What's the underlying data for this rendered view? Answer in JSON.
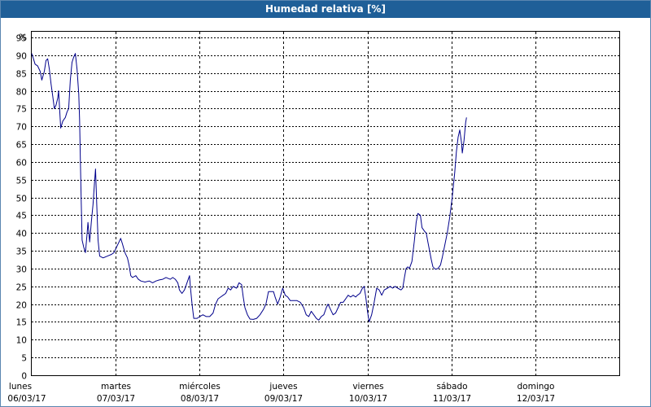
{
  "chart_data": {
    "type": "line",
    "title": "Humedad relativa [%]",
    "ylabel": "%",
    "xlabel": "",
    "ylim": [
      0,
      95
    ],
    "yticks": [
      0,
      5,
      10,
      15,
      20,
      25,
      30,
      35,
      40,
      45,
      50,
      55,
      60,
      65,
      70,
      75,
      80,
      85,
      90,
      95
    ],
    "xlim": [
      0,
      7
    ],
    "day_ticks": [
      {
        "day": "lunes",
        "date": "06/03/17"
      },
      {
        "day": "martes",
        "date": "07/03/17"
      },
      {
        "day": "miércoles",
        "date": "08/03/17"
      },
      {
        "day": "jueves",
        "date": "09/03/17"
      },
      {
        "day": "viernes",
        "date": "10/03/17"
      },
      {
        "day": "sábado",
        "date": "11/03/17"
      },
      {
        "day": "domingo",
        "date": "12/03/17"
      }
    ],
    "grid": true,
    "line_color": "#00008b",
    "series": [
      {
        "name": "",
        "points": [
          [
            0.0,
            90.5
          ],
          [
            0.02,
            89.0
          ],
          [
            0.04,
            87.5
          ],
          [
            0.07,
            87.0
          ],
          [
            0.1,
            85.5
          ],
          [
            0.12,
            83.0
          ],
          [
            0.15,
            85.5
          ],
          [
            0.17,
            88.5
          ],
          [
            0.19,
            89.0
          ],
          [
            0.21,
            86.0
          ],
          [
            0.23,
            82.0
          ],
          [
            0.25,
            78.5
          ],
          [
            0.27,
            75.0
          ],
          [
            0.29,
            76.0
          ],
          [
            0.31,
            78.0
          ],
          [
            0.32,
            80.0
          ],
          [
            0.33,
            76.0
          ],
          [
            0.345,
            69.5
          ],
          [
            0.37,
            71.5
          ],
          [
            0.4,
            72.5
          ],
          [
            0.42,
            74.0
          ],
          [
            0.44,
            75.0
          ],
          [
            0.46,
            83.0
          ],
          [
            0.48,
            88.0
          ],
          [
            0.5,
            89.5
          ],
          [
            0.52,
            90.5
          ],
          [
            0.54,
            86.0
          ],
          [
            0.56,
            79.0
          ],
          [
            0.57,
            72.0
          ],
          [
            0.58,
            60.0
          ],
          [
            0.59,
            48.0
          ],
          [
            0.6,
            38.0
          ],
          [
            0.62,
            36.0
          ],
          [
            0.64,
            34.5
          ],
          [
            0.66,
            40.0
          ],
          [
            0.67,
            43.0
          ],
          [
            0.69,
            37.5
          ],
          [
            0.71,
            43.0
          ],
          [
            0.73,
            48.0
          ],
          [
            0.75,
            55.0
          ],
          [
            0.76,
            58.0
          ],
          [
            0.775,
            48.0
          ],
          [
            0.79,
            38.0
          ],
          [
            0.81,
            33.5
          ],
          [
            0.85,
            33.0
          ],
          [
            0.9,
            33.5
          ],
          [
            0.95,
            34.0
          ],
          [
            0.98,
            34.5
          ],
          [
            1.0,
            35.5
          ],
          [
            1.04,
            37.5
          ],
          [
            1.06,
            38.5
          ],
          [
            1.08,
            37.0
          ],
          [
            1.11,
            34.5
          ],
          [
            1.14,
            33.0
          ],
          [
            1.16,
            31.0
          ],
          [
            1.18,
            28.0
          ],
          [
            1.2,
            27.5
          ],
          [
            1.24,
            28.0
          ],
          [
            1.27,
            27.0
          ],
          [
            1.3,
            26.5
          ],
          [
            1.35,
            26.2
          ],
          [
            1.4,
            26.5
          ],
          [
            1.44,
            26.0
          ],
          [
            1.48,
            26.5
          ],
          [
            1.52,
            26.8
          ],
          [
            1.56,
            27.0
          ],
          [
            1.6,
            27.5
          ],
          [
            1.65,
            27.0
          ],
          [
            1.68,
            27.5
          ],
          [
            1.71,
            27.0
          ],
          [
            1.74,
            26.0
          ],
          [
            1.76,
            24.0
          ],
          [
            1.79,
            23.0
          ],
          [
            1.82,
            24.0
          ],
          [
            1.85,
            26.0
          ],
          [
            1.88,
            28.0
          ],
          [
            1.89,
            25.0
          ],
          [
            1.91,
            20.0
          ],
          [
            1.93,
            16.0
          ],
          [
            1.97,
            16.0
          ],
          [
            2.0,
            16.5
          ],
          [
            2.04,
            17.0
          ],
          [
            2.08,
            16.5
          ],
          [
            2.12,
            16.5
          ],
          [
            2.16,
            17.5
          ],
          [
            2.19,
            20.0
          ],
          [
            2.22,
            21.5
          ],
          [
            2.25,
            22.0
          ],
          [
            2.28,
            22.5
          ],
          [
            2.31,
            23.0
          ],
          [
            2.34,
            24.5
          ],
          [
            2.37,
            24.0
          ],
          [
            2.4,
            25.0
          ],
          [
            2.44,
            24.5
          ],
          [
            2.47,
            26.0
          ],
          [
            2.5,
            25.5
          ],
          [
            2.52,
            22.0
          ],
          [
            2.54,
            19.0
          ],
          [
            2.57,
            17.0
          ],
          [
            2.6,
            15.8
          ],
          [
            2.64,
            15.7
          ],
          [
            2.68,
            16.0
          ],
          [
            2.72,
            17.0
          ],
          [
            2.76,
            18.5
          ],
          [
            2.79,
            20.0
          ],
          [
            2.82,
            23.5
          ],
          [
            2.85,
            23.5
          ],
          [
            2.88,
            23.5
          ],
          [
            2.9,
            22.0
          ],
          [
            2.93,
            20.0
          ],
          [
            2.96,
            22.0
          ],
          [
            2.99,
            24.5
          ],
          [
            3.02,
            22.5
          ],
          [
            3.05,
            22.0
          ],
          [
            3.08,
            21.0
          ],
          [
            3.12,
            21.0
          ],
          [
            3.16,
            21.0
          ],
          [
            3.2,
            20.5
          ],
          [
            3.24,
            19.0
          ],
          [
            3.27,
            17.0
          ],
          [
            3.3,
            16.5
          ],
          [
            3.33,
            18.0
          ],
          [
            3.36,
            17.0
          ],
          [
            3.39,
            16.0
          ],
          [
            3.42,
            15.5
          ],
          [
            3.45,
            16.5
          ],
          [
            3.48,
            17.0
          ],
          [
            3.51,
            19.0
          ],
          [
            3.53,
            20.0
          ],
          [
            3.56,
            18.5
          ],
          [
            3.59,
            17.0
          ],
          [
            3.62,
            17.5
          ],
          [
            3.65,
            19.0
          ],
          [
            3.68,
            20.5
          ],
          [
            3.71,
            20.5
          ],
          [
            3.74,
            21.5
          ],
          [
            3.77,
            22.5
          ],
          [
            3.8,
            22.0
          ],
          [
            3.83,
            22.5
          ],
          [
            3.86,
            22.0
          ],
          [
            3.88,
            22.5
          ],
          [
            3.91,
            23.0
          ],
          [
            3.94,
            24.5
          ],
          [
            3.96,
            25.0
          ],
          [
            3.98,
            22.0
          ],
          [
            4.0,
            18.0
          ],
          [
            4.02,
            15.0
          ],
          [
            4.05,
            17.0
          ],
          [
            4.08,
            20.5
          ],
          [
            4.11,
            24.5
          ],
          [
            4.14,
            24.0
          ],
          [
            4.17,
            22.5
          ],
          [
            4.2,
            24.0
          ],
          [
            4.24,
            24.5
          ],
          [
            4.27,
            25.0
          ],
          [
            4.3,
            24.5
          ],
          [
            4.33,
            25.0
          ],
          [
            4.36,
            24.5
          ],
          [
            4.4,
            24.0
          ],
          [
            4.42,
            24.5
          ],
          [
            4.44,
            27.5
          ],
          [
            4.46,
            30.0
          ],
          [
            4.48,
            30.5
          ],
          [
            4.5,
            30.0
          ],
          [
            4.53,
            32.0
          ],
          [
            4.56,
            38.0
          ],
          [
            4.58,
            43.0
          ],
          [
            4.6,
            45.5
          ],
          [
            4.63,
            45.0
          ],
          [
            4.65,
            41.5
          ],
          [
            4.68,
            40.5
          ],
          [
            4.7,
            40.0
          ],
          [
            4.72,
            37.5
          ],
          [
            4.74,
            35.0
          ],
          [
            4.76,
            32.5
          ],
          [
            4.78,
            30.5
          ],
          [
            4.81,
            29.8
          ],
          [
            4.84,
            30.0
          ],
          [
            4.87,
            31.0
          ],
          [
            4.89,
            33.0
          ],
          [
            4.92,
            36.5
          ],
          [
            4.95,
            40.0
          ],
          [
            4.98,
            44.5
          ],
          [
            5.01,
            50.0
          ],
          [
            5.04,
            57.0
          ],
          [
            5.06,
            63.0
          ],
          [
            5.08,
            67.0
          ],
          [
            5.1,
            69.0
          ],
          [
            5.12,
            65.5
          ],
          [
            5.13,
            62.5
          ],
          [
            5.15,
            66.0
          ],
          [
            5.17,
            71.0
          ],
          [
            5.18,
            72.5
          ]
        ]
      }
    ]
  }
}
